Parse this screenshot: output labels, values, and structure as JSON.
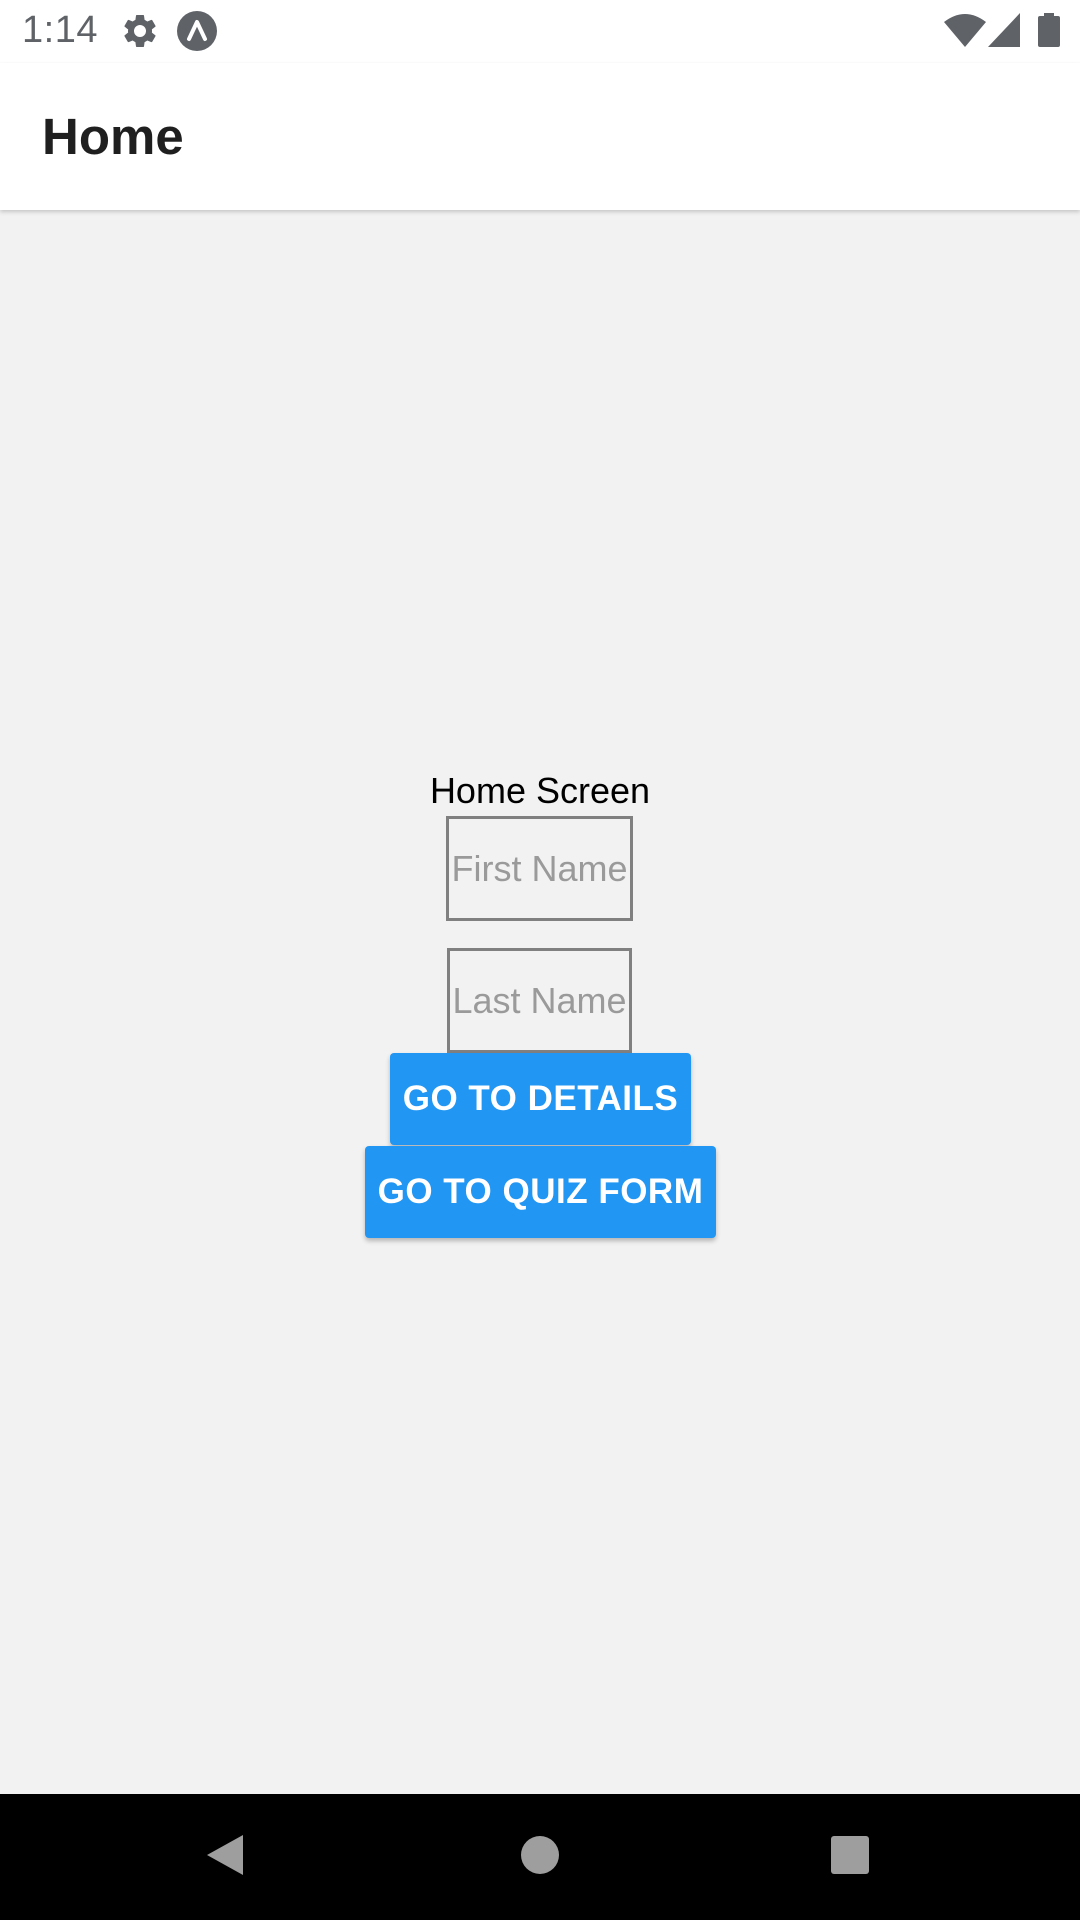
{
  "status_bar": {
    "time": "1:14",
    "icons_left": [
      "gear-icon",
      "app-notification-icon"
    ],
    "icons_right": [
      "wifi-icon",
      "cell-signal-icon",
      "battery-icon"
    ]
  },
  "app_bar": {
    "title": "Home"
  },
  "main": {
    "screen_label": "Home Screen",
    "first_name": {
      "placeholder": "First Name",
      "value": ""
    },
    "last_name": {
      "placeholder": "Last Name",
      "value": ""
    },
    "details_button_label": "GO TO DETAILS",
    "quiz_button_label": "GO TO QUIZ FORM"
  },
  "nav_bar": {
    "buttons": [
      "back-icon",
      "home-icon",
      "recents-icon"
    ]
  },
  "colors": {
    "primary_button": "#2196f3",
    "background": "#f2f2f2",
    "app_bar": "#ffffff",
    "nav_bar": "#000000"
  }
}
